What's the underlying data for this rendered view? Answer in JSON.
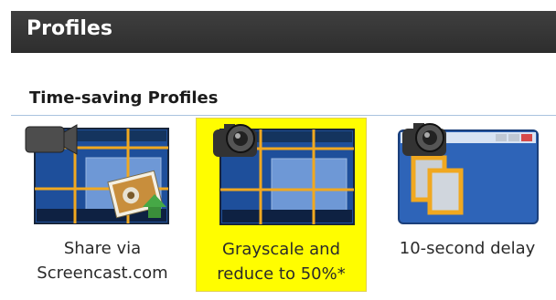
{
  "panel": {
    "title": "Profiles"
  },
  "section": {
    "heading": "Time-saving Profiles"
  },
  "profiles": [
    {
      "label": "Share via\nScreencast.com",
      "selected": false,
      "icon": "screencast-share-icon"
    },
    {
      "label": "Grayscale and\nreduce to 50%*",
      "selected": true,
      "icon": "camera-capture-grid-icon"
    },
    {
      "label": "10-second delay",
      "selected": false,
      "icon": "camera-window-delay-icon"
    }
  ],
  "colors": {
    "titlebar": "#333333",
    "selection": "#fffd00",
    "grid_lines": "#f0a820",
    "screen_blue": "#2e64b8"
  }
}
